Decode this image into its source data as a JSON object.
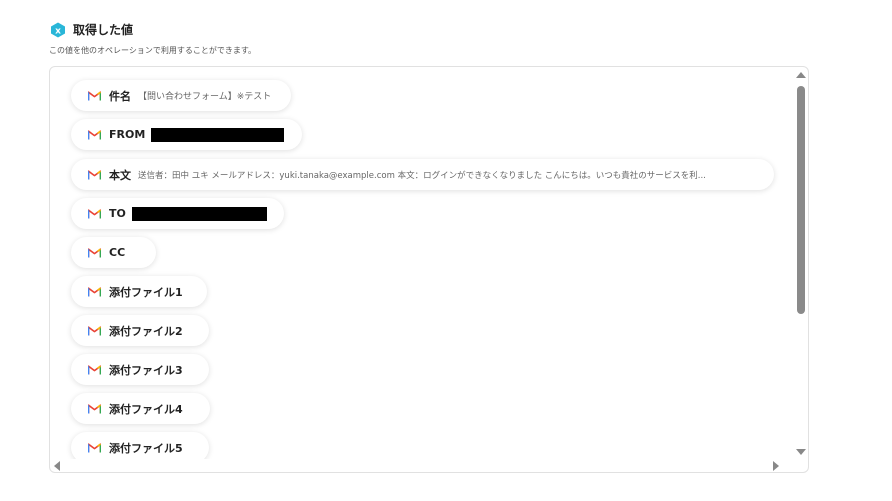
{
  "header": {
    "title": "取得した値",
    "icon": "variable-x-icon",
    "icon_color": "#29b6d8",
    "description": "この値を他のオペレーションで利用することができます。"
  },
  "fields": [
    {
      "label": "件名",
      "value": "【問い合わせフォーム】※テスト",
      "redacted": false,
      "icon": "gmail-icon"
    },
    {
      "label": "FROM",
      "value": "",
      "redacted": true,
      "icon": "gmail-icon"
    },
    {
      "label": "本文",
      "value": "送信者：田中 ユキ メールアドレス：yuki.tanaka@example.com 本文：ログインができなくなりました こんにちは。いつも貴社のサービスを利...",
      "redacted": false,
      "icon": "gmail-icon"
    },
    {
      "label": "TO",
      "value": "",
      "redacted": true,
      "icon": "gmail-icon"
    },
    {
      "label": "CC",
      "value": "",
      "redacted": false,
      "icon": "gmail-icon"
    },
    {
      "label": "添付ファイル1",
      "value": "",
      "redacted": false,
      "icon": "gmail-icon"
    },
    {
      "label": "添付ファイル2",
      "value": "",
      "redacted": false,
      "icon": "gmail-icon"
    },
    {
      "label": "添付ファイル3",
      "value": "",
      "redacted": false,
      "icon": "gmail-icon"
    },
    {
      "label": "添付ファイル4",
      "value": "",
      "redacted": false,
      "icon": "gmail-icon"
    },
    {
      "label": "添付ファイル5",
      "value": "",
      "redacted": false,
      "icon": "gmail-icon"
    }
  ]
}
